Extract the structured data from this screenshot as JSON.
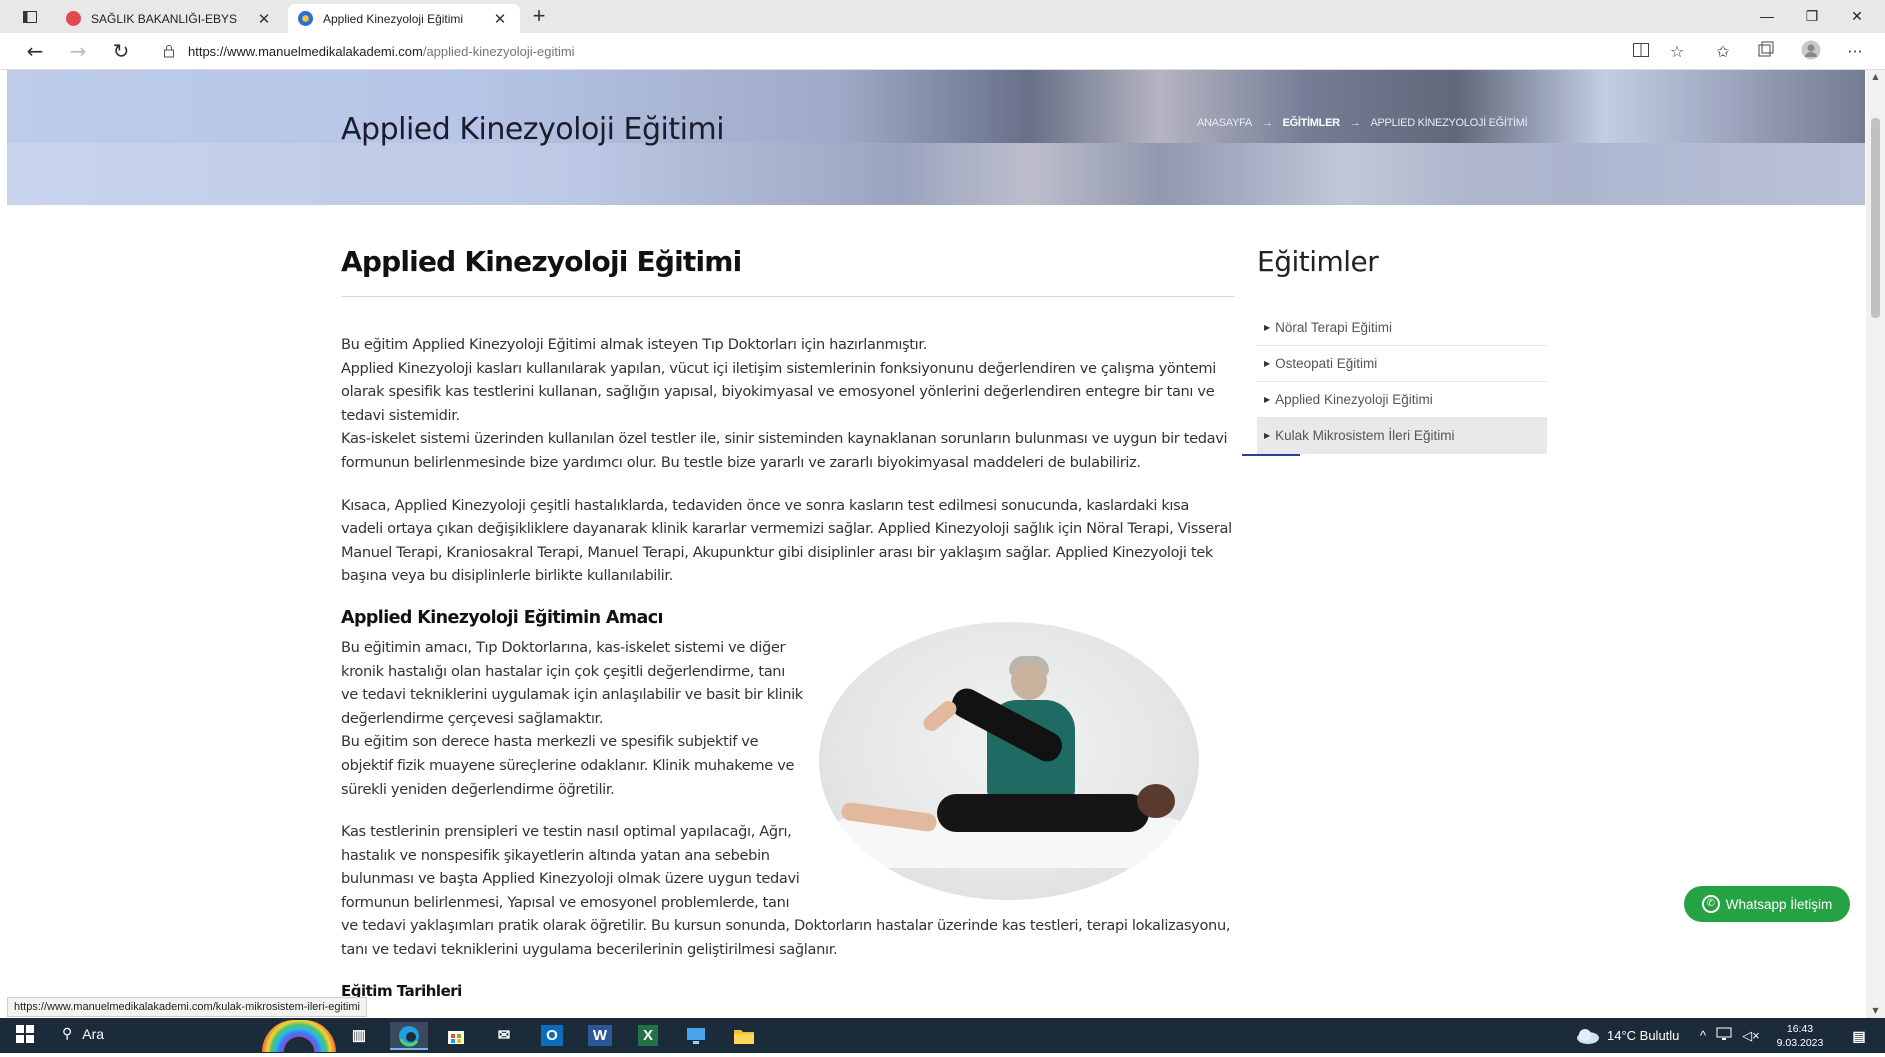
{
  "browser": {
    "tabs": [
      {
        "label": "SAĞLIK BAKANLIĞI-EBYS",
        "favicon_color": "#d9343a"
      },
      {
        "label": "Applied Kinezyoloji Eğitimi",
        "favicon_color": "#2b6fd6"
      }
    ],
    "url_host": "https://www.manuelmedikalakademi.com",
    "url_path": "/applied-kinezyoloji-egitimi",
    "new_tab_glyph": "+",
    "window_controls": [
      "—",
      "❐",
      "✕"
    ]
  },
  "hero": {
    "title": "Applied Kinezyoloji Eğitimi",
    "breadcrumb": [
      "ANASAYFA",
      "EĞİTİMLER",
      "APPLIED KİNEZYOLOJİ EĞİTİMİ"
    ],
    "breadcrumb_sep": "→"
  },
  "article": {
    "title": "Applied Kinezyoloji Eğitimi",
    "para1": "Bu eğitim Applied Kinezyoloji Eğitimi almak isteyen Tıp Doktorları için hazırlanmıştır.\nApplied Kinezyoloji kasları kullanılarak yapılan, vücut içi iletişim sistemlerinin fonksiyonunu değerlendiren ve çalışma yöntemi olarak spesifik kas testlerini kullanan, sağlığın yapısal, biyokimyasal ve emosyonel yönlerini değerlendiren entegre bir tanı ve tedavi sistemidir.\nKas-iskelet sistemi üzerinden kullanılan özel testler ile, sinir sisteminden kaynaklanan sorunların bulunması ve uygun bir tedavi formunun belirlenmesinde bize yardımcı olur. Bu testle bize yararlı ve zararlı biyokimyasal maddeleri de bulabiliriz.",
    "para2": "Kısaca, Applied Kinezyoloji çeşitli hastalıklarda,  tedaviden  önce ve sonra kasların test edilmesi sonucunda, kaslardaki kısa vadeli ortaya çıkan değişikliklere dayanarak klinik kararlar vermemizi sağlar. Applied Kinezyoloji sağlık için Nöral Terapi, Visseral Manuel Terapi, Kraniosakral Terapi, Manuel Terapi, Akupunktur gibi disiplinler arası bir yaklaşım sağlar. Applied Kinezyoloji tek başına veya  bu disiplinlerle birlikte kullanılabilir.",
    "subtitle": "Applied Kinezyoloji Eğitimin Amacı",
    "para3": "Bu eğitimin amacı, Tıp Doktorlarına, kas-iskelet sistemi  ve diğer kronik hastalığı olan hastalar için çok çeşitli değerlendirme, tanı ve tedavi tekniklerini uygulamak için anlaşılabilir ve basit bir klinik değerlendirme çerçevesi sağlamaktır.\nBu eğitim son derece hasta merkezli ve spesifik subjektif ve objektif fizik muayene süreçlerine odaklanır. Klinik muhakeme ve sürekli yeniden değerlendirme öğretilir.",
    "para4": "Kas testlerinin prensipleri ve testin nasıl optimal yapılacağı, Ağrı, hastalık ve nonspesifik şikayetlerin altında yatan ana sebebin bulunması ve başta Applied Kinezyoloji olmak üzere uygun tedavi formunun belirlenmesi,   Yapısal ve emosyonel problemlerde, tanı ve tedavi yaklaşımları pratik olarak öğretilir. Bu kursun sonunda, Doktorların hastalar üzerinde kas testleri, terapi lokalizasyonu, tanı ve tedavi tekniklerini uygulama becerilerinin geliştirilmesi sağlanır.",
    "subtitle2": "Eğitim Tarihleri"
  },
  "sidebar": {
    "title": "Eğitimler",
    "items": [
      {
        "label": "Nöral Terapi Eğitimi"
      },
      {
        "label": "Osteopati Eğitimi"
      },
      {
        "label": "Applied Kinezyoloji Eğitimi"
      },
      {
        "label": "Kulak Mikrosistem İleri Eğitimi"
      }
    ],
    "hovered_index": 3
  },
  "whatsapp": {
    "label": "Whatsapp İletişim"
  },
  "status_url": "https://www.manuelmedikalakademi.com/kulak-mikrosistem-ileri-egitimi",
  "taskbar": {
    "search_label": "Ara",
    "apps": [
      "Outlook",
      "Word",
      "Excel"
    ],
    "app_letters": {
      "outlook": "O",
      "word": "W",
      "excel": "X"
    },
    "weather": "14°C  Bulutlu",
    "time": "16:43",
    "date": "9.03.2023"
  },
  "colors": {
    "accent_blue": "#2f3f8f",
    "whatsapp_green": "#25a244",
    "taskbar": "#1c2b3a"
  }
}
